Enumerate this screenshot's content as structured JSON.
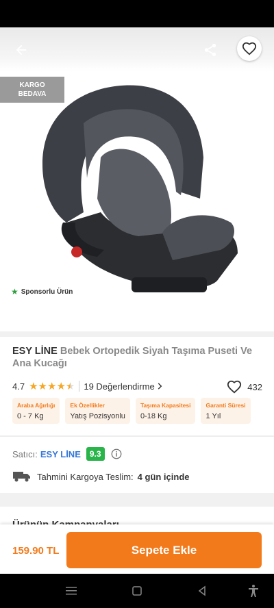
{
  "header": {
    "back_icon": "arrow-left-icon",
    "share_icon": "share-icon",
    "favorite_icon": "heart-outline-icon"
  },
  "badge": {
    "line1": "KARGO",
    "line2": "BEDAVA"
  },
  "sponsored": {
    "label": "Sponsorlu Ürün",
    "icon": "star-icon",
    "color": "#2e9e3e"
  },
  "product": {
    "brand": "ESY LİNE",
    "name": "Bebek Ortopedik Siyah Taşıma Puseti Ve Ana Kucağı",
    "rating": "4.7",
    "stars": 4.5,
    "reviews": "19 Değerlendirme",
    "favorites": "432"
  },
  "attributes": [
    {
      "label": "Araba Ağırlığı",
      "value": "0 - 7 Kg"
    },
    {
      "label": "Ek Özellikler",
      "value": "Yatış Pozisyonlu"
    },
    {
      "label": "Taşıma Kapasitesi",
      "value": "0-18 Kg"
    },
    {
      "label": "Garanti Süresi",
      "value": "1 Yıl"
    }
  ],
  "seller": {
    "label": "Satıcı:",
    "name": "ESY LİNE",
    "score": "9.3"
  },
  "delivery": {
    "label": "Tahmini Kargoya Teslim:",
    "days": "4 gün içinde"
  },
  "campaigns": {
    "title": "Ürünün Kampanyaları"
  },
  "bottom": {
    "price": "159.90 TL",
    "add_to_cart": "Sepete Ekle"
  },
  "colors": {
    "accent": "#f27a1a",
    "seller_link": "#3477d8",
    "score_bg": "#2ab54b",
    "star": "#f6a623"
  }
}
